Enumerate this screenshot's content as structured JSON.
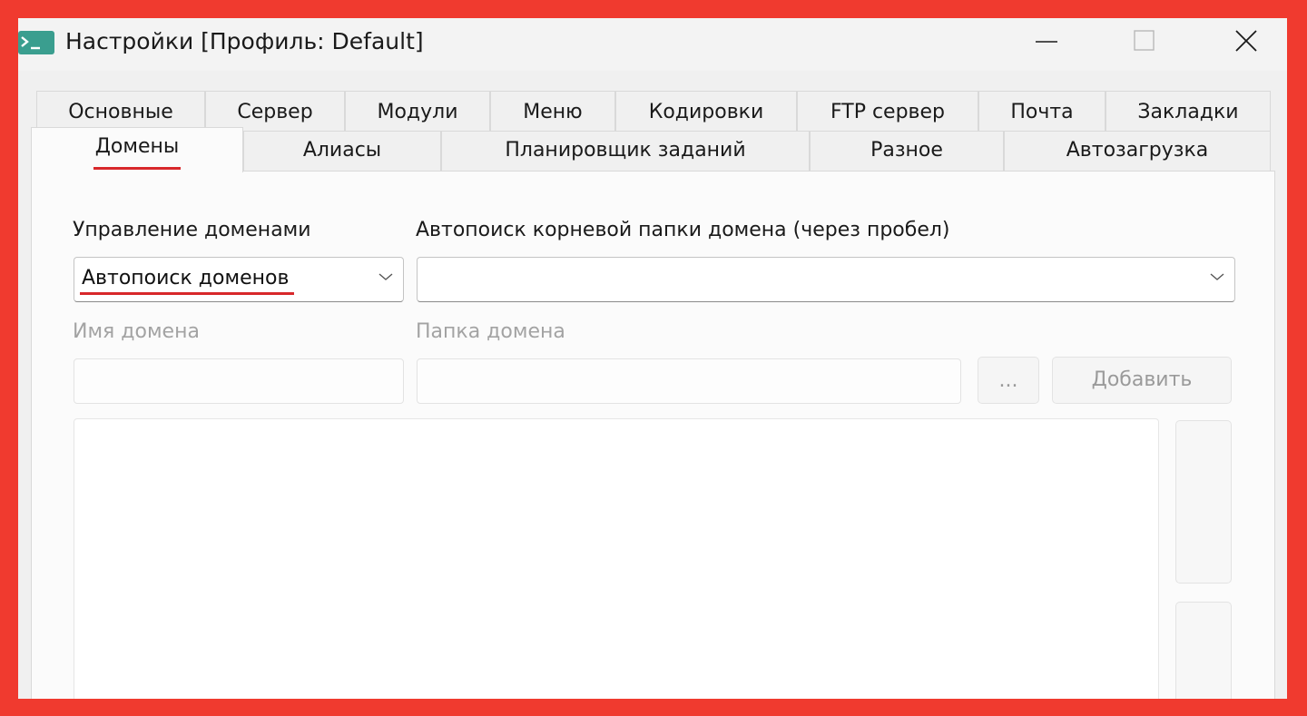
{
  "window": {
    "title": "Настройки [Профиль: Default]",
    "icon": "terminal-icon"
  },
  "title_controls": {
    "minimize_icon": "minimize-icon",
    "maximize_icon": "maximize-icon",
    "close_icon": "close-icon"
  },
  "tabs": {
    "row1": [
      "Основные",
      "Сервер",
      "Модули",
      "Меню",
      "Кодировки",
      "FTP сервер",
      "Почта",
      "Закладки"
    ],
    "row2": [
      "Домены",
      "Алиасы",
      "Планировщик заданий",
      "Разное",
      "Автозагрузка"
    ],
    "active": "Домены"
  },
  "domains": {
    "management_label": "Управление доменами",
    "management_value": "Автопоиск доменов",
    "autosearch_label": "Автопоиск корневой папки домена (через пробел)",
    "autosearch_value": "",
    "domain_name_label": "Имя домена",
    "domain_name_value": "",
    "domain_folder_label": "Папка домена",
    "domain_folder_value": "",
    "browse_button": "...",
    "add_button": "Добавить"
  },
  "colors": {
    "highlight_underline": "#d8282b",
    "frame": "#f03a2f",
    "disabled_text": "#a3a3a3"
  }
}
